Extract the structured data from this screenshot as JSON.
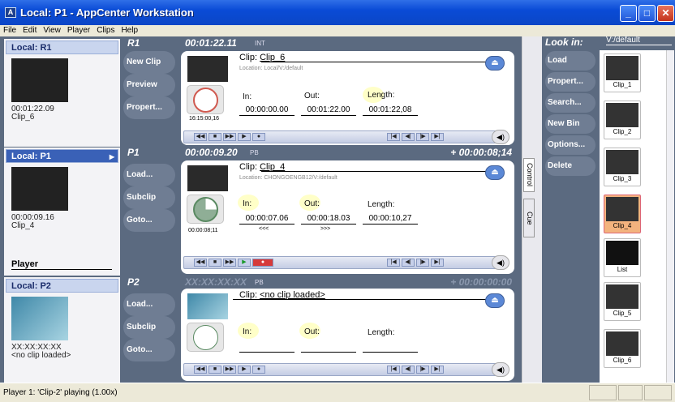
{
  "window": {
    "title": "Local: P1 - AppCenter Workstation",
    "app_icon": "A"
  },
  "menu": [
    "File",
    "Edit",
    "View",
    "Player",
    "Clips",
    "Help"
  ],
  "left": {
    "r1": {
      "header": "Local: R1",
      "timecode": "00:01:22.09",
      "clip": "Clip_6"
    },
    "p1": {
      "header": "Local: P1",
      "timecode": "00:00:09.16",
      "clip": "Clip_4"
    },
    "player_label": "Player",
    "p2": {
      "header": "Local: P2",
      "timecode": "XX:XX:XX:XX",
      "clip": "<no clip loaded>"
    }
  },
  "r1": {
    "name": "R1",
    "timecode": "00:01:22.11",
    "state": "INT",
    "buttons": [
      "New Clip",
      "Preview",
      "Propert..."
    ],
    "clip_label": "Clip:",
    "clip": "Clip_6",
    "location": "Location: Local/V:/default",
    "in_label": "In:",
    "out_label": "Out:",
    "length_label": "Length:",
    "in": "00:00:00.00",
    "out": "00:01:22.00",
    "length": "00:01:22,08",
    "clock": "16:15:00,16"
  },
  "p1": {
    "name": "P1",
    "timecode": "00:00:09.20",
    "state": "PB",
    "remaining": "+ 00:00:08;14",
    "buttons": [
      "Load...",
      "Subclip",
      "Goto..."
    ],
    "clip_label": "Clip:",
    "clip": "Clip_4",
    "location": "Location: CHONGOENGB12/V:/default",
    "in_label": "In:",
    "out_label": "Out:",
    "length_label": "Length:",
    "in": "00:00:07.06",
    "out": "00:00:18.03",
    "length": "00:00:10,27",
    "elapsed": "00:00:08;11",
    "rew": "<<<",
    "ffw": ">>>"
  },
  "p2": {
    "name": "P2",
    "timecode": "XX:XX:XX:XX",
    "state": "PB",
    "remaining": "+ 00:00:00:00",
    "buttons": [
      "Load...",
      "Subclip",
      "Goto..."
    ],
    "clip_label": "Clip:",
    "clip": "<no clip loaded>",
    "in_label": "In:",
    "out_label": "Out:",
    "length_label": "Length:"
  },
  "tabs": {
    "control": "Control",
    "cue": "Cue"
  },
  "bin": {
    "look_in": "Look in:",
    "path": "V:/default",
    "buttons": [
      "Load",
      "Propert...",
      "Search...",
      "New Bin",
      "Options...",
      "Delete"
    ],
    "clips": [
      "Clip_1",
      "Clip_2",
      "Clip_3",
      "Clip_4",
      "List",
      "Clip_5",
      "Clip_6"
    ]
  },
  "status": {
    "text": "Player 1: 'Clip-2' playing (1.00x)"
  }
}
